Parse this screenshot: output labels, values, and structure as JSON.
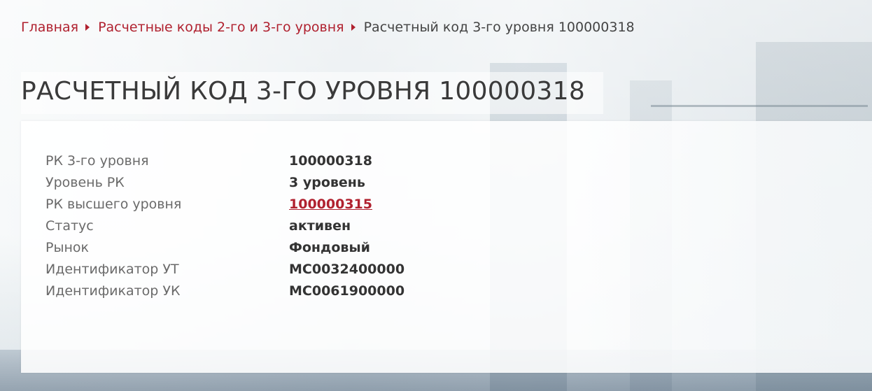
{
  "breadcrumb": {
    "home": "Главная",
    "section": "Расчетные коды 2-го и 3-го уровня",
    "current": "Расчетный код 3-го уровня 100000318"
  },
  "page": {
    "title": "РАСЧЕТНЫЙ КОД 3-ГО УРОВНЯ 100000318"
  },
  "details": [
    {
      "label": "РК 3-го уровня",
      "value": "100000318"
    },
    {
      "label": "Уровень РК",
      "value": "3 уровень"
    },
    {
      "label": "РК высшего уровня",
      "value": "100000315"
    },
    {
      "label": "Статус",
      "value": "активен"
    },
    {
      "label": "Рынок",
      "value": "Фондовый"
    },
    {
      "label": "Идентификатор УТ",
      "value": "MC0032400000"
    },
    {
      "label": "Идентификатор УК",
      "value": "MC0061900000"
    }
  ],
  "colors": {
    "accent": "#b0212f",
    "text": "#333333",
    "label": "#6a6a6a"
  },
  "icons": {
    "breadcrumb_separator": "caret-right-icon"
  }
}
